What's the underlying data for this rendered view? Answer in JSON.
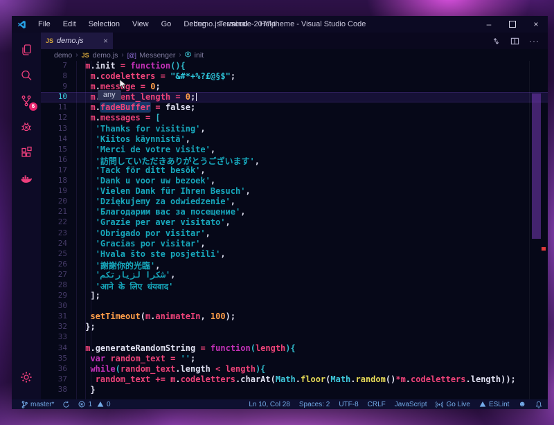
{
  "window": {
    "title": "demo.js - vscode-2077-theme - Visual Studio Code",
    "controls": {
      "minimize": "–",
      "close": "×"
    }
  },
  "menu": {
    "items": [
      "File",
      "Edit",
      "Selection",
      "View",
      "Go",
      "Debug",
      "Terminal",
      "Help"
    ]
  },
  "activity_bar": {
    "items": [
      "explorer",
      "search",
      "source-control",
      "debug",
      "extensions",
      "docker"
    ],
    "scm_badge": "6",
    "bottom": "settings"
  },
  "tab": {
    "file_type": "JS",
    "label": "demo.js",
    "close": "×"
  },
  "editor_actions": {
    "more": "···"
  },
  "breadcrumb": {
    "items": [
      "demo",
      "demo.js",
      "Messenger",
      "init"
    ],
    "separator": "›",
    "file_type": "JS",
    "namespace_glyph": "[@]"
  },
  "editor": {
    "hover_tooltip": "any",
    "active_line": 10,
    "code_lines": [
      {
        "num": 7,
        "segments": [
          [
            " "
          ],
          [
            "m",
            "p"
          ],
          [
            ".",
            "w"
          ],
          [
            "init",
            "w"
          ],
          [
            " "
          ],
          [
            "=",
            "p"
          ],
          [
            " "
          ],
          [
            "function",
            "k"
          ],
          [
            "(){",
            "b"
          ]
        ]
      },
      {
        "num": 8,
        "segments": [
          [
            "  "
          ],
          [
            "m",
            "p"
          ],
          [
            ".",
            "w"
          ],
          [
            "codeletters",
            "p"
          ],
          [
            " "
          ],
          [
            "=",
            "p"
          ],
          [
            " "
          ],
          [
            "\"&#*+%?£@§$\"",
            "s2"
          ],
          [
            ";",
            "w"
          ]
        ]
      },
      {
        "num": 9,
        "segments": [
          [
            "  "
          ],
          [
            "m",
            "p"
          ],
          [
            ".",
            "w"
          ],
          [
            "message",
            "p"
          ],
          [
            " "
          ],
          [
            "=",
            "p"
          ],
          [
            " "
          ],
          [
            "0",
            "o"
          ],
          [
            ";",
            "w"
          ]
        ]
      },
      {
        "num": 10,
        "segments": [
          [
            "  "
          ],
          [
            "m",
            "p"
          ],
          [
            ".",
            "w"
          ],
          {
            "t": "curre",
            "c": "p",
            "anchor": true
          },
          [
            "nt_length",
            "p"
          ],
          [
            " "
          ],
          [
            "=",
            "p"
          ],
          [
            " "
          ],
          [
            "0",
            "o"
          ],
          [
            ";",
            "w"
          ]
        ],
        "caret": true,
        "tooltip": true
      },
      {
        "num": 11,
        "segments": [
          [
            "  "
          ],
          [
            "m",
            "p"
          ],
          [
            ".",
            "w"
          ],
          {
            "t": "fadeBuffer",
            "c": "p",
            "wordhl": true
          },
          [
            " "
          ],
          [
            "=",
            "p"
          ],
          [
            " "
          ],
          [
            "false",
            "w"
          ],
          [
            ";",
            "w"
          ]
        ]
      },
      {
        "num": 12,
        "segments": [
          [
            "  "
          ],
          [
            "m",
            "p"
          ],
          [
            ".",
            "w"
          ],
          [
            "messages",
            "p"
          ],
          [
            " "
          ],
          [
            "=",
            "p"
          ],
          [
            " "
          ],
          [
            "[",
            "b"
          ]
        ]
      },
      {
        "num": 13,
        "segments": [
          [
            "   "
          ],
          [
            "'Thanks for visiting'",
            "s"
          ],
          [
            ",",
            "w"
          ]
        ]
      },
      {
        "num": 14,
        "segments": [
          [
            "   "
          ],
          [
            "'Kiitos käynnistä'",
            "s"
          ],
          [
            ",",
            "w"
          ]
        ]
      },
      {
        "num": 15,
        "segments": [
          [
            "   "
          ],
          [
            "'Merci de votre visite'",
            "s"
          ],
          [
            ",",
            "w"
          ]
        ]
      },
      {
        "num": 16,
        "segments": [
          [
            "   "
          ],
          [
            "'訪問していただきありがとうございます'",
            "s"
          ],
          [
            ",",
            "w"
          ]
        ]
      },
      {
        "num": 17,
        "segments": [
          [
            "   "
          ],
          [
            "'Tack för ditt besök'",
            "s"
          ],
          [
            ",",
            "w"
          ]
        ]
      },
      {
        "num": 18,
        "segments": [
          [
            "   "
          ],
          [
            "'Dank u voor uw bezoek'",
            "s"
          ],
          [
            ",",
            "w"
          ]
        ]
      },
      {
        "num": 19,
        "segments": [
          [
            "   "
          ],
          [
            "'Vielen Dank für Ihren Besuch'",
            "s"
          ],
          [
            ",",
            "w"
          ]
        ]
      },
      {
        "num": 20,
        "segments": [
          [
            "   "
          ],
          [
            "'Dziękujemy za odwiedzenie'",
            "s"
          ],
          [
            ",",
            "w"
          ]
        ]
      },
      {
        "num": 21,
        "segments": [
          [
            "   "
          ],
          [
            "'Благодарим вас за посещение'",
            "s"
          ],
          [
            ",",
            "w"
          ]
        ]
      },
      {
        "num": 22,
        "segments": [
          [
            "   "
          ],
          [
            "'Grazie per aver visitato'",
            "s"
          ],
          [
            ",",
            "w"
          ]
        ]
      },
      {
        "num": 23,
        "segments": [
          [
            "   "
          ],
          [
            "'Obrigado por visitar'",
            "s"
          ],
          [
            ",",
            "w"
          ]
        ]
      },
      {
        "num": 24,
        "segments": [
          [
            "   "
          ],
          [
            "'Gracias por visitar'",
            "s"
          ],
          [
            ",",
            "w"
          ]
        ]
      },
      {
        "num": 25,
        "segments": [
          [
            "   "
          ],
          [
            "'Hvala što ste posjetili'",
            "s"
          ],
          [
            ",",
            "w"
          ]
        ]
      },
      {
        "num": 26,
        "segments": [
          [
            "   "
          ],
          [
            "'謝謝你的光臨'",
            "s"
          ],
          [
            ",",
            "w"
          ]
        ]
      },
      {
        "num": 27,
        "segments": [
          [
            "   "
          ],
          [
            "'شكرا لزيارتكم'",
            "s"
          ],
          [
            ",",
            "w"
          ]
        ]
      },
      {
        "num": 28,
        "segments": [
          [
            "   "
          ],
          [
            "'आने के लिए धंयवाद'",
            "s"
          ]
        ]
      },
      {
        "num": 29,
        "segments": [
          [
            "  "
          ],
          [
            "];",
            "w"
          ]
        ]
      },
      {
        "num": 30,
        "segments": []
      },
      {
        "num": 31,
        "segments": [
          [
            "  "
          ],
          [
            "setTimeout",
            "o"
          ],
          [
            "(",
            "w"
          ],
          [
            "m",
            "p"
          ],
          [
            ".",
            "w"
          ],
          [
            "animateIn",
            "p"
          ],
          [
            ",",
            "w"
          ],
          [
            " "
          ],
          [
            "100",
            "o"
          ],
          [
            ");",
            "w"
          ]
        ]
      },
      {
        "num": 32,
        "segments": [
          [
            " "
          ],
          [
            "};",
            "w"
          ]
        ]
      },
      {
        "num": 33,
        "segments": []
      },
      {
        "num": 34,
        "segments": [
          [
            " "
          ],
          [
            "m",
            "p"
          ],
          [
            ".",
            "w"
          ],
          [
            "generateRandomString",
            "w"
          ],
          [
            " "
          ],
          [
            "=",
            "p"
          ],
          [
            " "
          ],
          [
            "function",
            "k"
          ],
          [
            "(",
            "b"
          ],
          [
            "length",
            "p"
          ],
          [
            "){",
            "b"
          ]
        ]
      },
      {
        "num": 35,
        "segments": [
          [
            "  "
          ],
          [
            "var",
            "k"
          ],
          [
            " "
          ],
          [
            "random_text",
            "p"
          ],
          [
            " "
          ],
          [
            "=",
            "p"
          ],
          [
            " "
          ],
          [
            "''",
            "s"
          ],
          [
            ";",
            "w"
          ]
        ]
      },
      {
        "num": 36,
        "segments": [
          [
            "  "
          ],
          [
            "while",
            "k"
          ],
          [
            "(",
            "b"
          ],
          [
            "random_text",
            "p"
          ],
          [
            ".",
            "w"
          ],
          [
            "length",
            "w"
          ],
          [
            " "
          ],
          [
            "<",
            "p"
          ],
          [
            " "
          ],
          [
            "length",
            "p"
          ],
          [
            "){",
            "b"
          ]
        ]
      },
      {
        "num": 37,
        "segments": [
          [
            "   "
          ],
          [
            "random_text",
            "p"
          ],
          [
            " "
          ],
          [
            "+=",
            "p"
          ],
          [
            " "
          ],
          [
            "m",
            "p"
          ],
          [
            ".",
            "w"
          ],
          [
            "codeletters",
            "p"
          ],
          [
            ".",
            "w"
          ],
          [
            "charAt",
            "w"
          ],
          [
            "(",
            "w"
          ],
          [
            "Math",
            "c"
          ],
          [
            ".",
            "w"
          ],
          [
            "floor",
            "y"
          ],
          [
            "(",
            "w"
          ],
          [
            "Math",
            "c"
          ],
          [
            ".",
            "w"
          ],
          [
            "random",
            "y"
          ],
          [
            "()",
            "w"
          ],
          [
            "*",
            "p"
          ],
          [
            "m",
            "p"
          ],
          [
            ".",
            "w"
          ],
          [
            "codeletters",
            "p"
          ],
          [
            ".",
            "w"
          ],
          [
            "length",
            "w"
          ],
          [
            "));",
            "w"
          ]
        ]
      },
      {
        "num": 38,
        "segments": [
          [
            "  "
          ],
          [
            "}",
            "w"
          ]
        ]
      }
    ]
  },
  "statusbar": {
    "branch": "master*",
    "errors": "1",
    "warnings": "0",
    "cursor": "Ln 10, Col 28",
    "indent": "Spaces: 2",
    "encoding": "UTF-8",
    "eol": "CRLF",
    "language": "JavaScript",
    "go_live": "Go Live",
    "eslint": "ESLint"
  },
  "colors": {
    "accent_pink": "#ee4379",
    "keyword_magenta": "#c431b8",
    "string_teal": "#17a8bc",
    "number_orange": "#ff9e4a",
    "cyan": "#3fc9dd",
    "yellow": "#e5d957",
    "activity_icon": "#ef3f7d",
    "badge": "#e9246e",
    "statusbar_text": "#74abe8",
    "js_badge": "#d9a93c",
    "editor_bg": "#060818",
    "titlebar_bg": "#0c0a23",
    "active_line_number": "#3bd4e4",
    "error_dot": "#e03a3a"
  }
}
